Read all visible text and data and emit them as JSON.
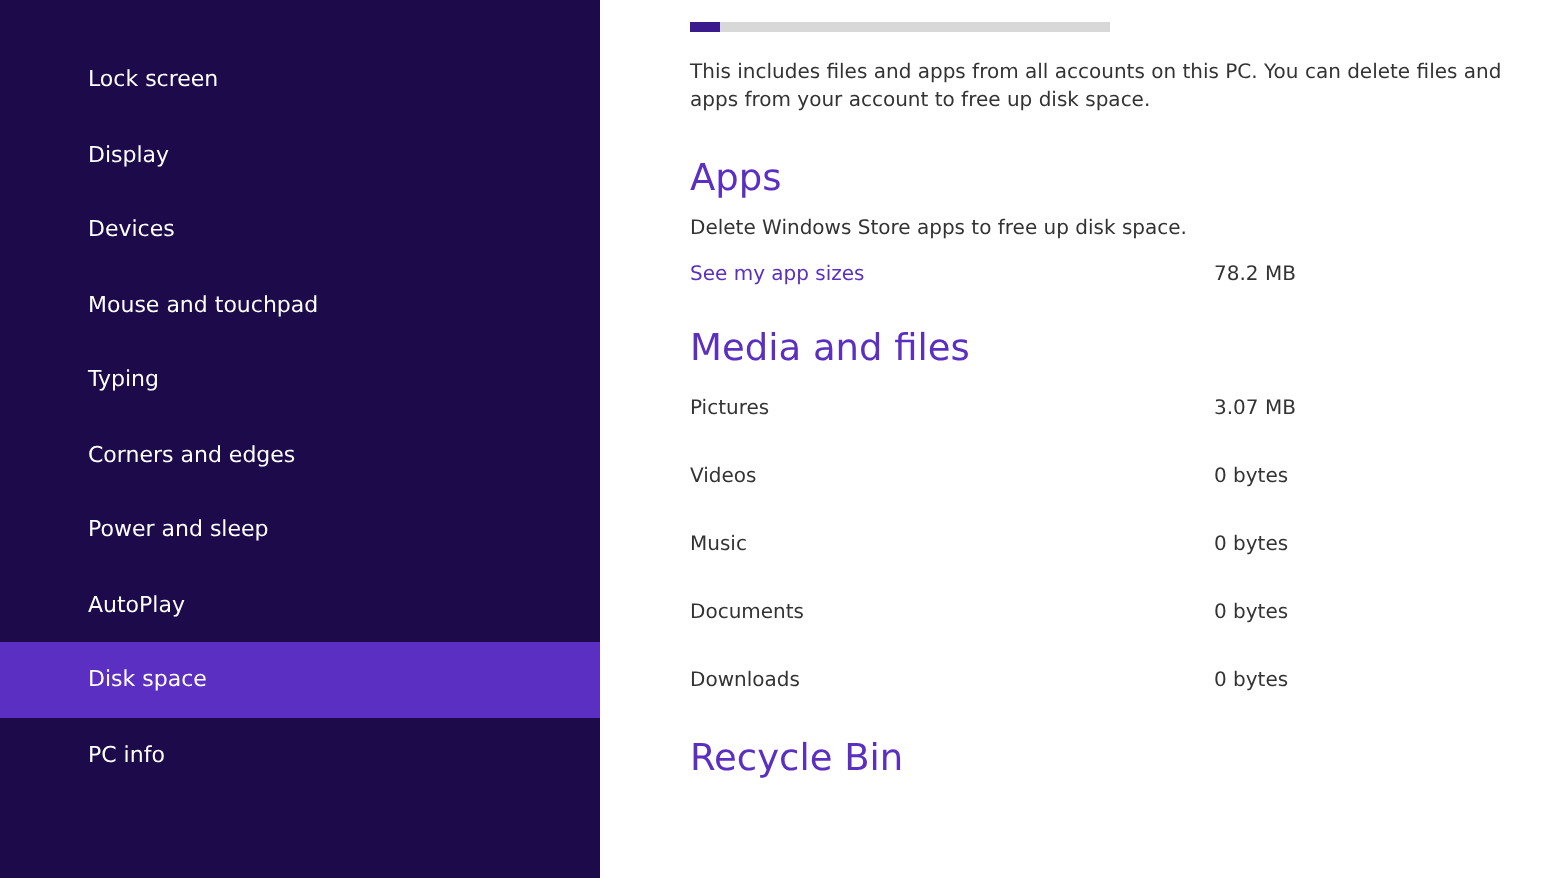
{
  "sidebar": {
    "items": [
      {
        "label": "Lock screen",
        "selected": false
      },
      {
        "label": "Display",
        "selected": false
      },
      {
        "label": "Devices",
        "selected": false
      },
      {
        "label": "Mouse and touchpad",
        "selected": false
      },
      {
        "label": "Typing",
        "selected": false
      },
      {
        "label": "Corners and edges",
        "selected": false
      },
      {
        "label": "Power and sleep",
        "selected": false
      },
      {
        "label": "AutoPlay",
        "selected": false
      },
      {
        "label": "Disk space",
        "selected": true
      },
      {
        "label": "PC info",
        "selected": false
      }
    ]
  },
  "storage": {
    "level": 0.07,
    "description": "This includes files and apps from all accounts on this PC. You can delete files and apps from your account to free up disk space."
  },
  "apps": {
    "heading": "Apps",
    "description": "Delete Windows Store apps to free up disk space.",
    "link": "See my app sizes",
    "size": "78.2 MB"
  },
  "media": {
    "heading": "Media and files",
    "rows": [
      {
        "label": "Pictures",
        "value": "3.07 MB"
      },
      {
        "label": "Videos",
        "value": "0 bytes"
      },
      {
        "label": "Music",
        "value": "0 bytes"
      },
      {
        "label": "Documents",
        "value": "0 bytes"
      },
      {
        "label": "Downloads",
        "value": "0 bytes"
      }
    ]
  },
  "recycle_bin": {
    "heading": "Recycle Bin"
  }
}
